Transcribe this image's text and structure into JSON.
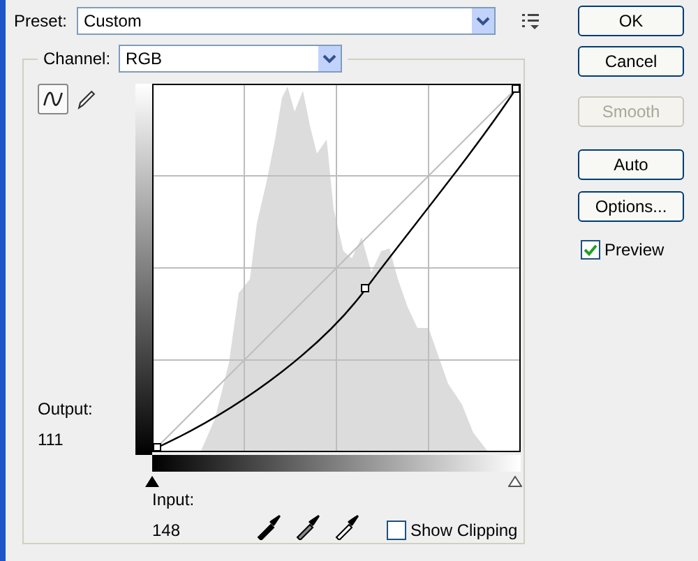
{
  "preset": {
    "label": "Preset:",
    "value": "Custom"
  },
  "channel": {
    "label": "Channel:",
    "value": "RGB"
  },
  "curve_tools": [
    {
      "kind": "curve",
      "selected": true
    },
    {
      "kind": "pencil",
      "selected": false
    }
  ],
  "output": {
    "label": "Output:",
    "value": "111"
  },
  "input": {
    "label": "Input:",
    "value": "148"
  },
  "show_clipping": {
    "label": "Show Clipping",
    "checked": false
  },
  "buttons": [
    {
      "label": "OK",
      "disabled": false
    },
    {
      "label": "Cancel",
      "disabled": false
    },
    {
      "label": "Smooth",
      "disabled": true
    },
    {
      "label": "Auto",
      "disabled": false
    },
    {
      "label": "Options...",
      "disabled": false
    }
  ],
  "preview": {
    "label": "Preview",
    "checked": true
  }
}
